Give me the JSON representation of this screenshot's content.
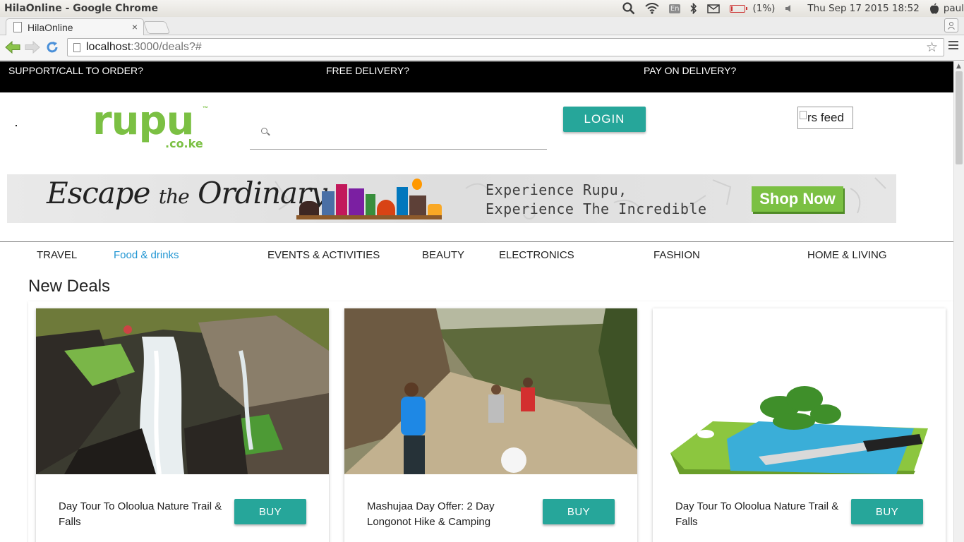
{
  "os": {
    "window_title": "HilaOnline - Google Chrome",
    "keyboard_layout": "En",
    "battery": "(1%)",
    "clock": "Thu Sep 17 2015 18:52",
    "user": "paul"
  },
  "browser": {
    "tab_title": "HilaOnline",
    "tab_close": "×",
    "url_host": "localhost",
    "url_path": ":3000/deals?#"
  },
  "topbar": {
    "support": "SUPPORT/CALL TO ORDER?",
    "delivery": "FREE DELIVERY?",
    "payment": "PAY ON DELIVERY?"
  },
  "header": {
    "logo_word": "rupu",
    "logo_tld": ".co.ke",
    "logo_tm": "™",
    "search_value": "",
    "login_label": "LOGIN",
    "rss_alt": "rs feed"
  },
  "banner": {
    "escape_1": "Escape",
    "escape_the": "the",
    "escape_2": "Ordinary",
    "tagline_1": "Experience Rupu,",
    "tagline_2": "Experience The Incredible",
    "cta": "Shop Now"
  },
  "categories": [
    {
      "label": "TRAVEL"
    },
    {
      "label": "Food & drinks"
    },
    {
      "label": "EVENTS & ACTIVITIES"
    },
    {
      "label": "BEAUTY"
    },
    {
      "label": "ELECTRONICS"
    },
    {
      "label": "FASHION"
    },
    {
      "label": "HOME & LIVING"
    }
  ],
  "deals": {
    "heading": "New Deals",
    "items": [
      {
        "title": "Day Tour To Oloolua Nature Trail & Falls",
        "buy_label": "BUY"
      },
      {
        "title": "Mashujaa Day Offer: 2 Day Longonot Hike & Camping",
        "buy_label": "BUY"
      },
      {
        "title": "Day Tour To Oloolua Nature Trail & Falls",
        "buy_label": "BUY"
      }
    ]
  },
  "colors": {
    "accent_teal": "#26a69a",
    "brand_green": "#7bc043",
    "active_category": "#2196d3"
  }
}
